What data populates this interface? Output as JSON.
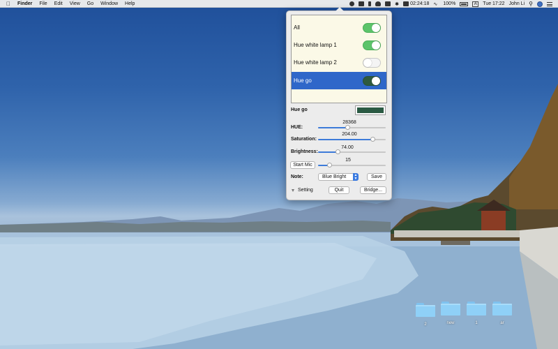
{
  "menubar": {
    "app_name": "Finder",
    "menus": [
      "File",
      "Edit",
      "View",
      "Go",
      "Window",
      "Help"
    ],
    "timer": "02:24:18",
    "battery": "100%",
    "input_source": "A",
    "clock": "Tue 17:22",
    "user": "John Li"
  },
  "popover": {
    "lamps": [
      {
        "label": "All",
        "on": true
      },
      {
        "label": "Hue white lamp 1",
        "on": true
      },
      {
        "label": "Hue white lamp 2",
        "on": false
      },
      {
        "label": "Hue go",
        "on": true,
        "selected": true
      }
    ],
    "selected_name": "Hue go",
    "selected_color": "#2a5a43",
    "hue": {
      "label": "HUE:",
      "value": "28368",
      "fraction": 0.43
    },
    "saturation": {
      "label": "Saturation:",
      "value": "204.00",
      "fraction": 0.8
    },
    "brightness": {
      "label": "Brightness:",
      "value": "74.00",
      "fraction": 0.29
    },
    "mic": {
      "button_label": "Start Mic",
      "value": "15",
      "fraction": 0.17
    },
    "note_label": "Note:",
    "note_value": "Blue Bright",
    "save_label": "Save",
    "setting_label": "Setting",
    "quit_label": "Quit",
    "bridge_label": "Bridge..."
  },
  "desktop": {
    "folders": [
      "2",
      "new",
      "1",
      "ar"
    ]
  },
  "colors": {
    "selection": "#2f67c9",
    "toggle_on": "#5cc46a",
    "slider_fill": "#3d7bd9"
  }
}
